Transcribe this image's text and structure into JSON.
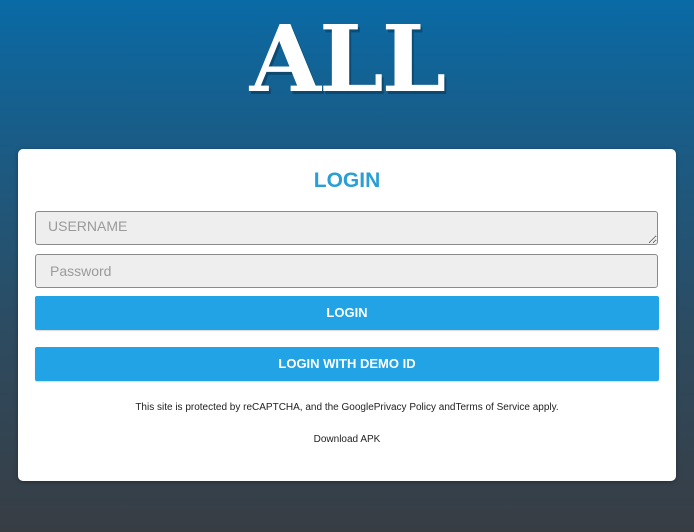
{
  "brand": {
    "logo_text": "ALL"
  },
  "login": {
    "title": "LOGIN",
    "username_placeholder": "USERNAME",
    "password_placeholder": "Password",
    "login_button": "LOGIN",
    "demo_button": "LOGIN WITH DEMO ID"
  },
  "footer": {
    "recaptcha_prefix": "This site is protected by reCAPTCHA, and the Google",
    "privacy_link": "Privacy Policy",
    "and_text": " and",
    "terms_link": "Terms of Service",
    "apply_text": " apply.",
    "download_link": "Download APK"
  },
  "colors": {
    "accent": "#21a3e6",
    "title": "#2a9fd6",
    "card_bg": "#ffffff"
  }
}
